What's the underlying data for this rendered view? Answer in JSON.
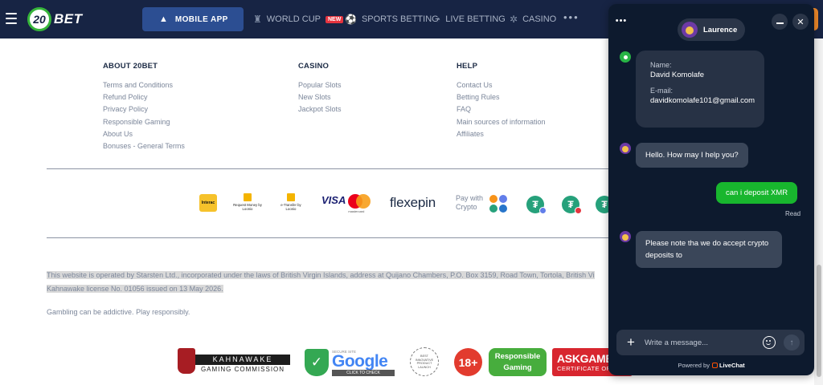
{
  "nav": {
    "logo_number": "20",
    "logo_text": "BET",
    "mobile_app": "MOBILE APP",
    "links": [
      {
        "label": "WORLD CUP",
        "badge": "NEW"
      },
      {
        "label": "SPORTS BETTING"
      },
      {
        "label": "LIVE BETTING"
      },
      {
        "label": "CASINO"
      }
    ],
    "more": "•••"
  },
  "footer": {
    "about": {
      "title": "ABOUT 20BET",
      "items": [
        "Terms and Conditions",
        "Refund Policy",
        "Privacy Policy",
        "Responsible Gaming",
        "About Us",
        "Bonuses - General Terms"
      ]
    },
    "casino": {
      "title": "CASINO",
      "items": [
        "Popular Slots",
        "New Slots",
        "Jackpot Slots"
      ]
    },
    "help": {
      "title": "HELP",
      "items": [
        "Contact Us",
        "Betting Rules",
        "FAQ",
        "Main sources of information",
        "Affiliates"
      ]
    }
  },
  "payments": {
    "interac": "Interac",
    "loonie1": "Request Money by Loonio",
    "loonie2": "e-Transfer by Loonio",
    "visa": "VISA",
    "mastercard": "mastercard",
    "flexepin": "flexepin",
    "pay_with": "Pay with",
    "crypto": "Crypto",
    "tether_symbol": "₮"
  },
  "legal": {
    "text_line1": "This website is operated by Starsten Ltd., incorporated under the laws of British Virgin Islands, address at Quijano Chambers, P.O. Box 3159, Road Town, Tortola, British Vi",
    "text_line2": "Kahnawake license No. 01056 issued on 13 May 2026.",
    "gambling": "Gambling can be addictive. Play responsibly."
  },
  "badges": {
    "kahnawake_1": "KAHNAWAKE",
    "kahnawake_2": "GAMING COMMISSION",
    "google_small": "SECURE SITE",
    "google": "Google",
    "google_cta": "CLICK TO CHECK",
    "seal": "BEST INNOVATIVE PRODUCT LAUNCH",
    "age": "18+",
    "responsible_1": "Responsible",
    "responsible_2": "Gaming",
    "ask_1": "ASKGAMB",
    "ask_2": "CERTIFICATE OF"
  },
  "chat": {
    "menu": "•••",
    "agent_name": "Laurence",
    "close": "✕",
    "form": {
      "name_label": "Name:",
      "name_value": "David Komolafe",
      "email_label": "E-mail:",
      "email_value": "davidkomolafe101@gmail.com"
    },
    "messages": [
      {
        "from": "agent",
        "text": "Hello. How may I help you?"
      },
      {
        "from": "user",
        "text": "can i deposit XMR",
        "status": "Read"
      },
      {
        "from": "agent",
        "text": "Please note tha we do accept crypto deposits to"
      }
    ],
    "input_placeholder": "Write a message...",
    "plus": "+",
    "send": "↑",
    "powered_by": "Powered by",
    "powered_brand": "LiveChat"
  },
  "colors": {
    "nav_bg": "#172444",
    "chat_bg": "#0d1a2e",
    "user_bubble": "#18b62e",
    "agent_bubble": "#3a4659",
    "brand_green": "#36b53a"
  }
}
